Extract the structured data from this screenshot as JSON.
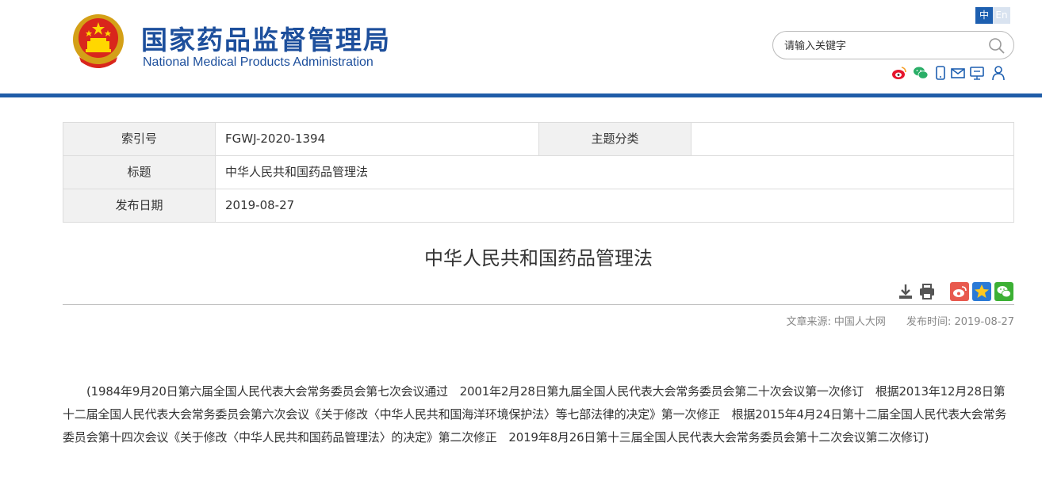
{
  "header": {
    "title_cn": "国家药品监督管理局",
    "title_en": "National Medical Products Administration",
    "lang_cn": "中",
    "lang_en": "En",
    "search_placeholder": "请输入关键字",
    "social_icons": [
      "weibo-icon",
      "wechat-icon",
      "mobile-icon",
      "mail-icon",
      "message-board-icon",
      "user-icon"
    ],
    "brand_color": "#1d4f9c"
  },
  "meta": {
    "index_label": "索引号",
    "index_value": "FGWJ-2020-1394",
    "topic_label": "主题分类",
    "topic_value": "",
    "title_label": "标题",
    "title_value": "中华人民共和国药品管理法",
    "date_label": "发布日期",
    "date_value": "2019-08-27"
  },
  "article": {
    "title": "中华人民共和国药品管理法",
    "source_label": "文章来源:",
    "source_value": "中国人大网",
    "publish_label": "发布时间:",
    "publish_value": "2019-08-27",
    "body": "(1984年9月20日第六届全国人民代表大会常务委员会第七次会议通过　2001年2月28日第九届全国人民代表大会常务委员会第二十次会议第一次修订　根据2013年12月28日第十二届全国人民代表大会常务委员会第六次会议《关于修改〈中华人民共和国海洋环境保护法〉等七部法律的决定》第一次修正　根据2015年4月24日第十二届全国人民代表大会常务委员会第十四次会议《关于修改〈中华人民共和国药品管理法〉的决定》第二次修正　2019年8月26日第十三届全国人民代表大会常务委员会第十二次会议第二次修订)"
  },
  "tools": [
    "download-icon",
    "print-icon",
    "share-weibo-icon",
    "share-qzone-icon",
    "share-wechat-icon"
  ]
}
